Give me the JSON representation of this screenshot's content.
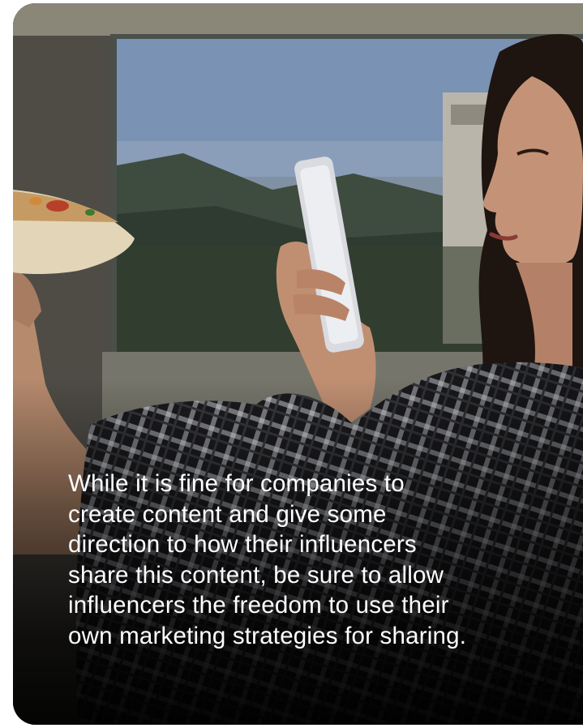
{
  "card": {
    "quote_lines": [
      "While it is fine for companies to",
      "create content and give some",
      "direction to how their influencers",
      "share this content, be sure to allow",
      "influencers the freedom to use their",
      "own marketing strategies for sharing."
    ]
  },
  "colors": {
    "text": "#ffffff",
    "shirt_dark": "#1c1c1e",
    "wall": "#6a6b60",
    "painting_sky": "#7d93b0"
  }
}
